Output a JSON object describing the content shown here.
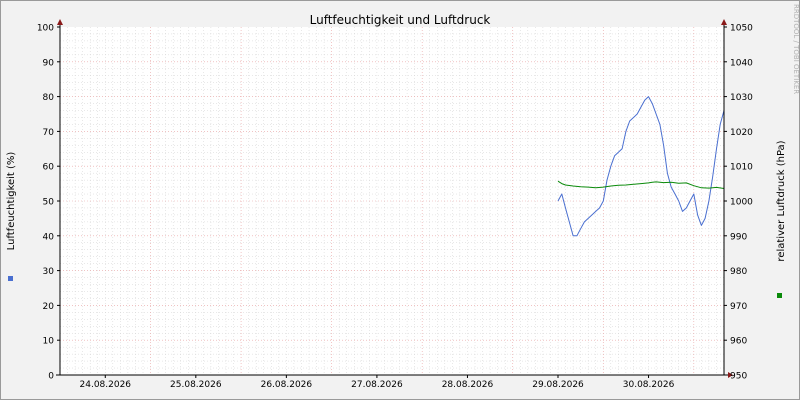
{
  "chart_data": {
    "type": "line",
    "title": "Luftfeuchtigkeit und Luftdruck",
    "ylabel": "Luftfeuchtigkeit (%)",
    "y2label": "relativer Luftdruck (hPa)",
    "watermark": "RRDTOOL / TOBI OETIKER",
    "ylim": [
      0,
      100
    ],
    "y2lim": [
      950,
      1050
    ],
    "yticks": [
      "0",
      "10",
      "20",
      "30",
      "40",
      "50",
      "60",
      "70",
      "80",
      "90",
      "100"
    ],
    "y2ticks": [
      "950",
      "960",
      "970",
      "980",
      "990",
      "1000",
      "1010",
      "1020",
      "1030",
      "1040",
      "1050"
    ],
    "x_start": "23.08.2026 12:00",
    "x_end": "30.08.2026 20:00",
    "xticks": [
      "24.08.2026",
      "25.08.2026",
      "26.08.2026",
      "27.08.2026",
      "28.08.2026",
      "29.08.2026",
      "30.08.2026"
    ],
    "grid": true,
    "colors": {
      "humidity": "#4a6fd0",
      "pressure": "#0a8a0a",
      "major_grid": "#e8a0a0",
      "minor_grid": "#d0d0d0",
      "axis": "#000000",
      "arrow": "#8b1a1a"
    },
    "series": [
      {
        "key": "humidity",
        "axis": "left",
        "x": [
          "29.08.2026 00:00",
          "29.08.2026 01:00",
          "29.08.2026 02:00",
          "29.08.2026 03:00",
          "29.08.2026 04:00",
          "29.08.2026 05:00",
          "29.08.2026 06:00",
          "29.08.2026 07:00",
          "29.08.2026 08:00",
          "29.08.2026 09:00",
          "29.08.2026 10:00",
          "29.08.2026 11:00",
          "29.08.2026 12:00",
          "29.08.2026 13:00",
          "29.08.2026 14:00",
          "29.08.2026 15:00",
          "29.08.2026 16:00",
          "29.08.2026 17:00",
          "29.08.2026 18:00",
          "29.08.2026 19:00",
          "29.08.2026 20:00",
          "29.08.2026 21:00",
          "29.08.2026 22:00",
          "29.08.2026 23:00",
          "30.08.2026 00:00",
          "30.08.2026 01:00",
          "30.08.2026 02:00",
          "30.08.2026 03:00",
          "30.08.2026 04:00",
          "30.08.2026 05:00",
          "30.08.2026 06:00",
          "30.08.2026 07:00",
          "30.08.2026 08:00",
          "30.08.2026 09:00",
          "30.08.2026 10:00",
          "30.08.2026 11:00",
          "30.08.2026 12:00",
          "30.08.2026 13:00",
          "30.08.2026 14:00",
          "30.08.2026 15:00",
          "30.08.2026 16:00",
          "30.08.2026 17:00",
          "30.08.2026 18:00",
          "30.08.2026 19:00",
          "30.08.2026 20:00"
        ],
        "values": [
          50,
          52,
          48,
          44,
          40,
          40,
          42,
          44,
          45,
          46,
          47,
          48,
          50,
          56,
          60,
          63,
          64,
          65,
          70,
          73,
          74,
          75,
          77,
          79,
          80,
          78,
          75,
          72,
          66,
          58,
          54,
          52,
          50,
          47,
          48,
          50,
          52,
          46,
          43,
          45,
          50,
          57,
          65,
          72,
          76
        ]
      },
      {
        "key": "pressure",
        "axis": "right",
        "x": [
          "29.08.2026 00:00",
          "29.08.2026 01:00",
          "29.08.2026 02:00",
          "29.08.2026 04:00",
          "29.08.2026 06:00",
          "29.08.2026 08:00",
          "29.08.2026 10:00",
          "29.08.2026 12:00",
          "29.08.2026 14:00",
          "29.08.2026 16:00",
          "29.08.2026 18:00",
          "29.08.2026 20:00",
          "29.08.2026 22:00",
          "30.08.2026 00:00",
          "30.08.2026 01:00",
          "30.08.2026 02:00",
          "30.08.2026 04:00",
          "30.08.2026 06:00",
          "30.08.2026 08:00",
          "30.08.2026 10:00",
          "30.08.2026 12:00",
          "30.08.2026 14:00",
          "30.08.2026 16:00",
          "30.08.2026 18:00",
          "30.08.2026 20:00"
        ],
        "values": [
          1005.7,
          1005.0,
          1004.6,
          1004.3,
          1004.1,
          1004.0,
          1003.8,
          1004.0,
          1004.3,
          1004.5,
          1004.6,
          1004.8,
          1005.0,
          1005.2,
          1005.4,
          1005.5,
          1005.3,
          1005.4,
          1005.1,
          1005.2,
          1004.4,
          1003.8,
          1003.7,
          1003.9,
          1003.6
        ]
      }
    ]
  }
}
